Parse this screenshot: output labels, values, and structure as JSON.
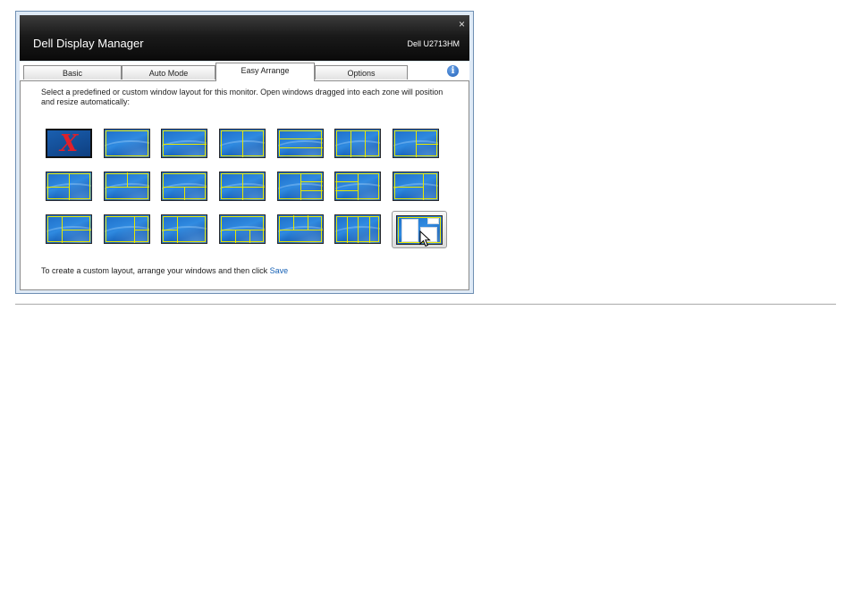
{
  "window": {
    "title": "Dell Display Manager",
    "monitor": "Dell U2713HM",
    "close_glyph": "×"
  },
  "tabs": [
    {
      "label": "Basic",
      "active": false
    },
    {
      "label": "Auto Mode",
      "active": false
    },
    {
      "label": "Easy Arrange",
      "active": true
    },
    {
      "label": "Options",
      "active": false
    }
  ],
  "info_icon": {
    "icon": "info-icon",
    "glyph": "i"
  },
  "panel": {
    "description": "Select a predefined or custom window layout for this monitor. Open windows dragged into each zone will position and resize automatically:",
    "footer_prefix": "To create a custom layout, arrange your windows and then click ",
    "footer_link": "Save"
  },
  "layouts": {
    "none_glyph": "X",
    "count": 21,
    "selected_index": 20
  },
  "colors": {
    "zone_line": "#e8e800",
    "link": "#1560b5",
    "titlebar": "#0a0a0a",
    "none_mark": "#e0202a"
  }
}
